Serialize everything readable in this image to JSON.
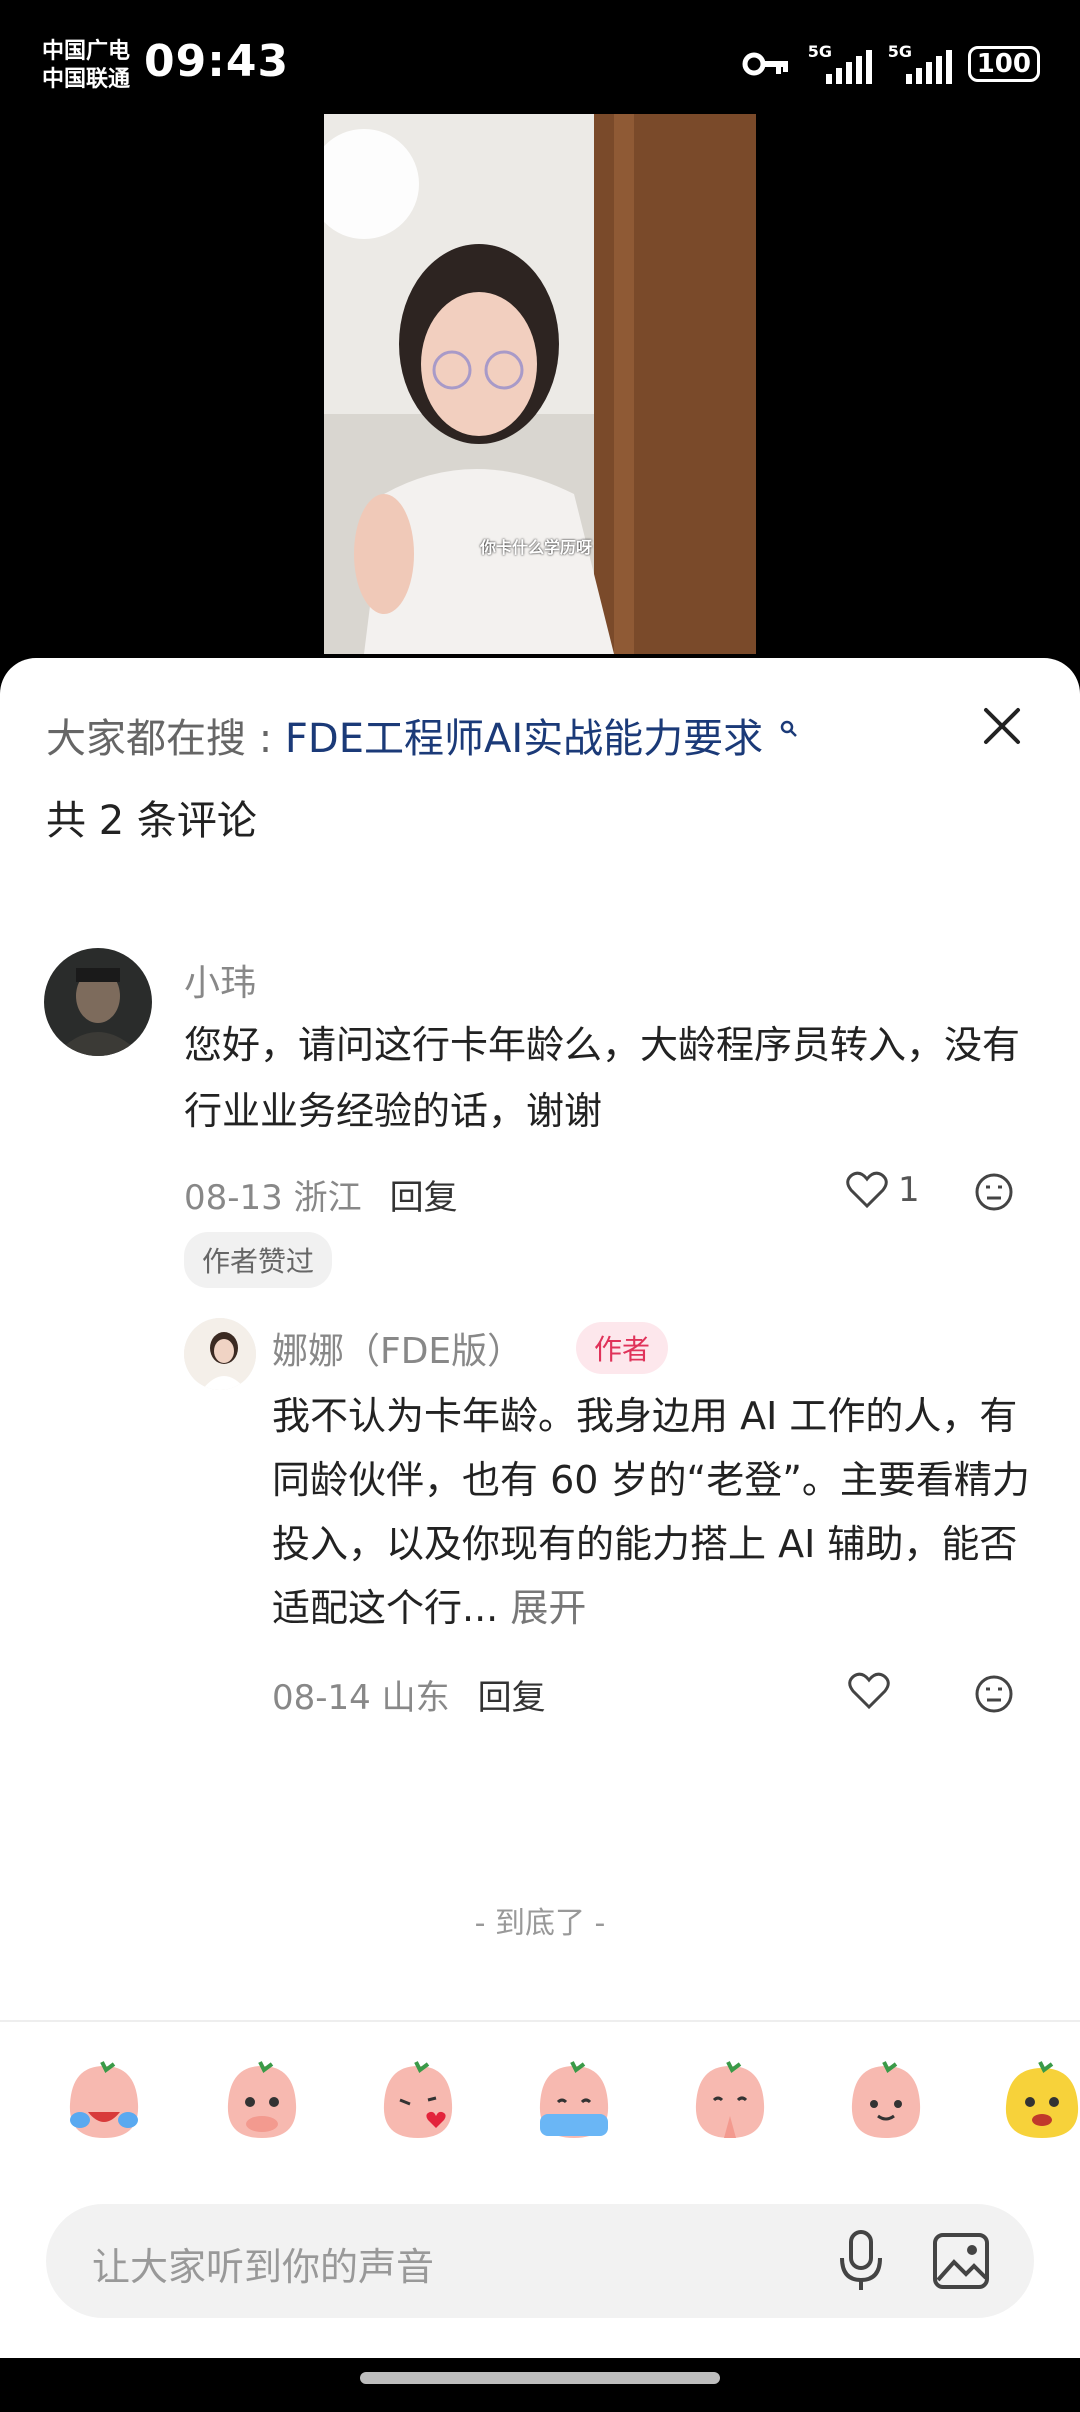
{
  "status": {
    "carrier1": "中国广电",
    "carrier2": "中国联通",
    "time": "09:43",
    "net1": "5G",
    "net2": "5G",
    "battery": "100"
  },
  "video": {
    "caption": "你卡什么学历呀"
  },
  "search": {
    "prefix": "大家都在搜",
    "separator": ":",
    "keyword": "FDE工程师AI实战能力要求"
  },
  "comments_header": {
    "count_label": "共 2 条评论"
  },
  "comment1": {
    "username": "小玮",
    "text": "您好，请问这行卡年龄么，大龄程序员转入，没有行业业务经验的话，谢谢",
    "date_loc": "08-13 浙江",
    "reply_label": "回复",
    "likes": "1",
    "liked_by_author": "作者赞过"
  },
  "comment2": {
    "username": "娜娜（FDE版）",
    "badge": "作者",
    "text": "我不认为卡年龄。我身边用 AI 工作的人，有同龄伙伴，也有 60 岁的“老登”。主要看精力投入，以及你现有的能力搭上 AI 辅助，能否适配这个行...",
    "expand_label": "展开",
    "date_loc": "08-14 山东",
    "reply_label": "回复"
  },
  "end_note": "- 到底了 -",
  "input": {
    "placeholder": "让大家听到你的声音"
  },
  "emoji_names": [
    "crying-laugh",
    "shy-cover",
    "kiss-heart",
    "cry-tears",
    "pray",
    "smile",
    "yellow-face"
  ],
  "colors": {
    "link_blue": "#1b3a78",
    "author_red": "#e0335a"
  }
}
